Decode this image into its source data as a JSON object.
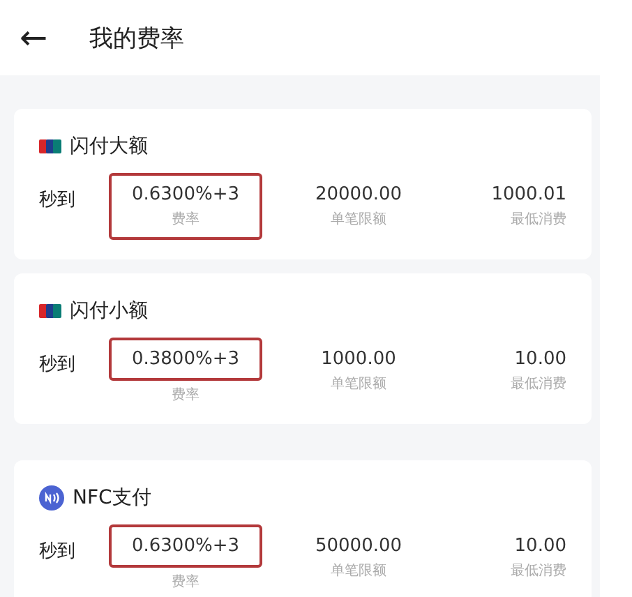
{
  "header": {
    "back": "←",
    "title": "我的费率"
  },
  "cards": [
    {
      "kind": "card",
      "title": "闪付大额",
      "settlement": "秒到",
      "rate": "0.6300%+3",
      "rate_label": "费率",
      "limit": "20000.00",
      "limit_label": "单笔限额",
      "minimum": "1000.01",
      "minimum_label": "最低消费",
      "highlighted": true,
      "label_highlighted": true
    },
    {
      "kind": "card",
      "title": "闪付小额",
      "settlement": "秒到",
      "rate": "0.3800%+3",
      "rate_label": "费率",
      "limit": "1000.00",
      "limit_label": "单笔限额",
      "minimum": "10.00",
      "minimum_label": "最低消费",
      "highlighted": true,
      "label_highlighted": false
    },
    {
      "kind": "nfc",
      "title": "NFC支付",
      "settlement": "秒到",
      "rate": "0.6300%+3",
      "rate_label": "费率",
      "limit": "50000.00",
      "limit_label": "单笔限额",
      "minimum": "10.00",
      "minimum_label": "最低消费",
      "highlighted": true,
      "label_highlighted": false
    }
  ]
}
